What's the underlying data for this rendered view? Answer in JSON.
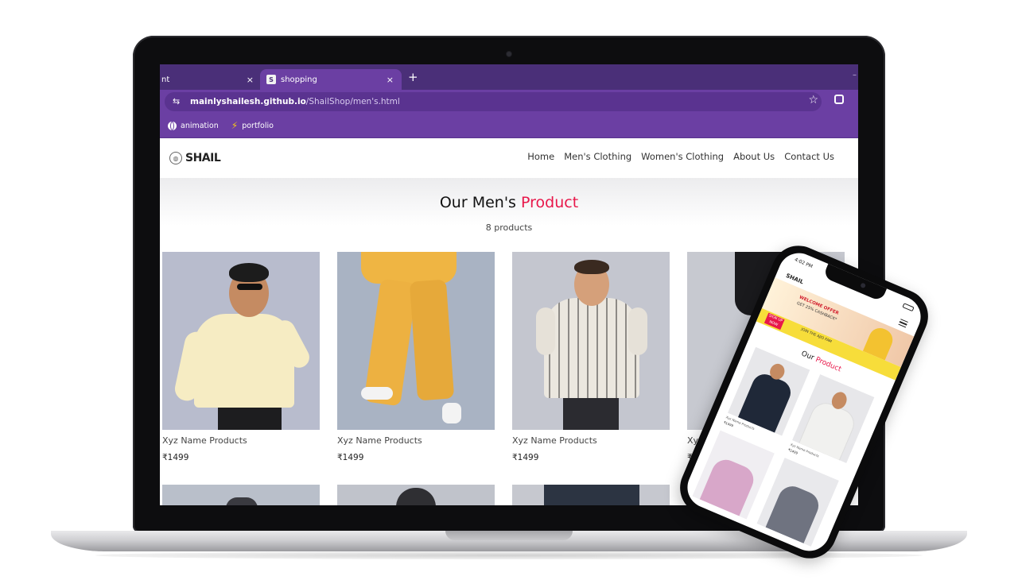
{
  "browser": {
    "tabs": [
      {
        "title": "nt",
        "active": false
      },
      {
        "title": "shopping",
        "active": true
      }
    ],
    "favicon_letter": "S",
    "close_glyph": "×",
    "new_tab_glyph": "+",
    "url_host": "mainlyshailesh.github.io",
    "url_path": "/ShailShop/men's.html",
    "bookmarks": [
      {
        "label": "animation",
        "icon": "globe-icon"
      },
      {
        "label": "portfolio",
        "icon": "bolt-icon"
      }
    ]
  },
  "site": {
    "logo_text": "SHAIL",
    "nav": [
      "Home",
      "Men's Clothing",
      "Women's Clothing",
      "About Us",
      "Contact Us"
    ],
    "heading_main": "Our Men's",
    "heading_accent": "Product",
    "product_count": "8 products",
    "products": [
      {
        "name": "Xyz Name Products",
        "price": "₹1499"
      },
      {
        "name": "Xyz Name Products",
        "price": "₹1499"
      },
      {
        "name": "Xyz Name Products",
        "price": "₹1499"
      },
      {
        "name": "Xyz",
        "price": "₹1"
      }
    ]
  },
  "phone": {
    "status_time": "4:02 PM",
    "logo_text": "SHAIL",
    "banner_title": "WELCOME OFFER",
    "banner_sub": "GET 25% CASHBACK*",
    "signup_label": "SIGN UP NOW",
    "join_text": "JOIN THE AJIO FAM",
    "heading_main": "Our",
    "heading_accent": "Product",
    "products": [
      {
        "name": "Xyz Name Products",
        "price": "₹1499"
      },
      {
        "name": "Xyz Name Products",
        "price": "₹1499"
      }
    ]
  },
  "colors": {
    "tabbar": "#4a2f78",
    "toolbar": "#6b3fa3",
    "accent": "#e8174a"
  }
}
